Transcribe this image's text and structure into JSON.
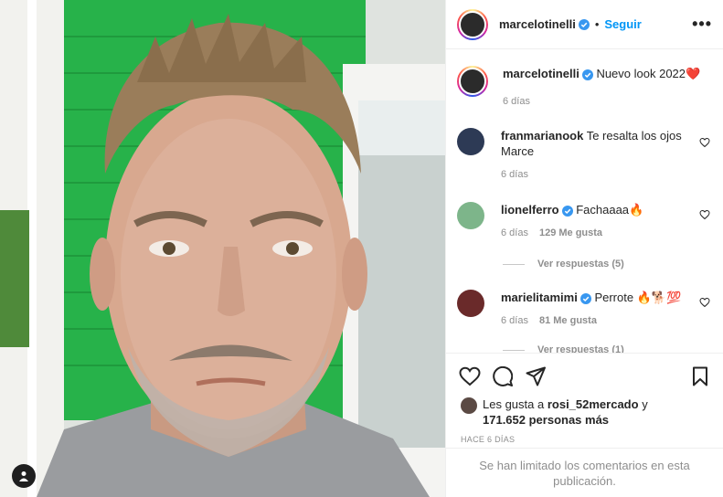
{
  "post": {
    "author": "marcelotinelli",
    "follow_label": "Seguir",
    "dot": "•",
    "more": "•••"
  },
  "caption": {
    "username": "marcelotinelli",
    "text": "Nuevo look 2022❤️",
    "time": "6 días"
  },
  "comments": [
    {
      "username": "franmarianook",
      "text": "Te resalta los ojos Marce",
      "time": "6 días",
      "likes": ""
    },
    {
      "username": "lionelferro",
      "text": "Fachaaaa🔥",
      "time": "6 días",
      "likes": "129 Me gusta",
      "replies": "Ver respuestas (5)"
    },
    {
      "username": "marielitamimi",
      "text": "Perrote 🔥🐕💯",
      "time": "6 días",
      "likes": "81 Me gusta",
      "replies": "Ver respuestas (1)"
    }
  ],
  "likes": {
    "prefix": "Les gusta a",
    "user": "rosi_52mercado",
    "mid": "y",
    "count": "171.652 personas más"
  },
  "time_ago": "HACE 6 DÍAS",
  "limited_notice": "Se han limitado los comentarios en esta publicación.",
  "icons": [
    "verified-badge-icon",
    "heart-icon",
    "comment-icon",
    "share-icon",
    "bookmark-icon",
    "user-tag-icon",
    "more-options-icon"
  ],
  "colors": {
    "accent": "#0095f6",
    "muted": "#8e8e8e",
    "wall_green": "#27b24a"
  }
}
